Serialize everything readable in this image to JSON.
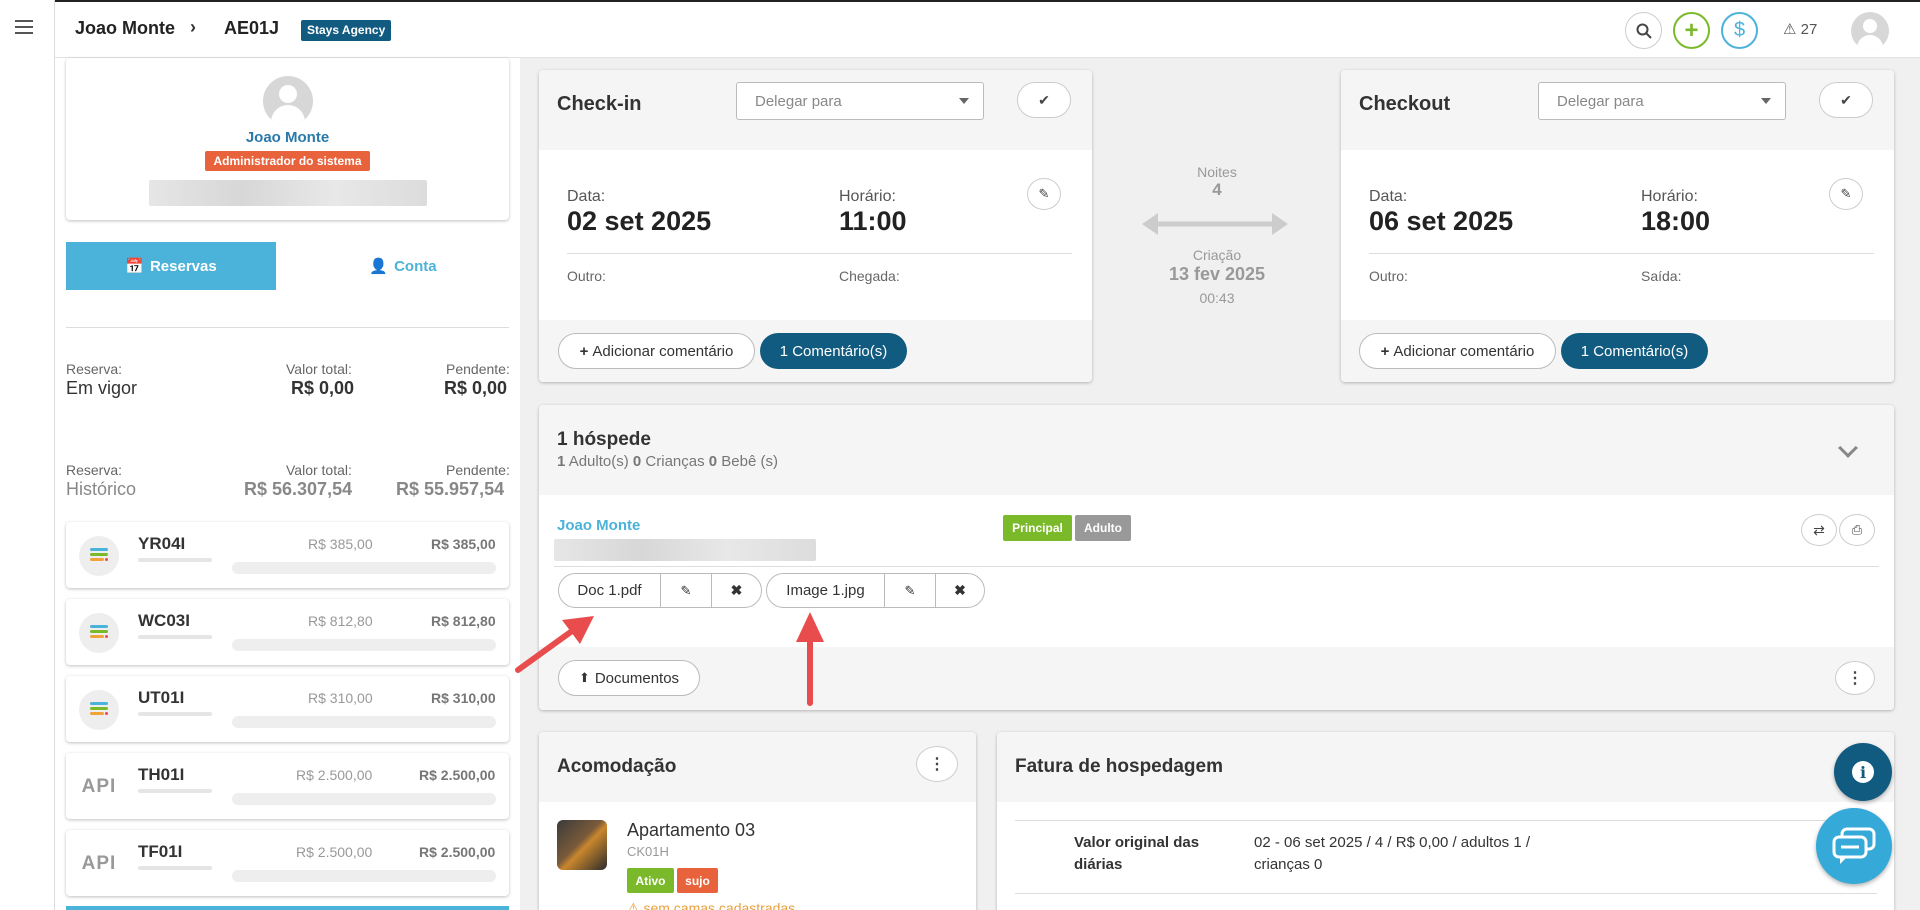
{
  "header": {
    "guest_name": "Joao Monte",
    "reservation_code": "AE01J",
    "agency_badge": "Stays Agency",
    "alerts_count": "27"
  },
  "profile": {
    "name": "Joao Monte",
    "role": "Administrador do sistema"
  },
  "side_tabs": {
    "reservations": "Reservas",
    "account": "Conta"
  },
  "summary_current": {
    "reserva_label": "Reserva:",
    "reserva_value": "Em vigor",
    "total_label": "Valor total:",
    "total_value": "R$ 0,00",
    "pending_label": "Pendente:",
    "pending_value": "R$ 0,00"
  },
  "summary_history": {
    "reserva_label": "Reserva:",
    "reserva_value": "Histórico",
    "total_label": "Valor total:",
    "total_value": "R$ 56.307,54",
    "pending_label": "Pendente:",
    "pending_value": "R$ 55.957,54"
  },
  "reservations": [
    {
      "code": "YR04I",
      "total": "R$ 385,00",
      "pending": "R$ 385,00",
      "source": "stack"
    },
    {
      "code": "WC03I",
      "total": "R$ 812,80",
      "pending": "R$ 812,80",
      "source": "stack"
    },
    {
      "code": "UT01I",
      "total": "R$ 310,00",
      "pending": "R$ 310,00",
      "source": "stack"
    },
    {
      "code": "TH01I",
      "total": "R$ 2.500,00",
      "pending": "R$ 2.500,00",
      "source": "API"
    },
    {
      "code": "TF01I",
      "total": "R$ 2.500,00",
      "pending": "R$ 2.500,00",
      "source": "API"
    }
  ],
  "checkin": {
    "title": "Check-in",
    "delegate_placeholder": "Delegar para",
    "date_label": "Data:",
    "date_value": "02 set 2025",
    "time_label": "Horário:",
    "time_value": "11:00",
    "other_label": "Outro:",
    "arrival_label": "Chegada:",
    "add_comment": "Adicionar comentário",
    "comments": "1 Comentário(s)"
  },
  "checkout": {
    "title": "Checkout",
    "delegate_placeholder": "Delegar para",
    "date_label": "Data:",
    "date_value": "06 set 2025",
    "time_label": "Horário:",
    "time_value": "18:00",
    "other_label": "Outro:",
    "departure_label": "Saída:",
    "add_comment": "Adicionar comentário",
    "comments": "1 Comentário(s)"
  },
  "stay": {
    "nights_label": "Noites",
    "nights_value": "4",
    "created_label": "Criação",
    "created_date": "13 fev 2025",
    "created_time": "00:43"
  },
  "guests": {
    "title": "1 hóspede",
    "adults_count": "1",
    "adults_label": "Adulto(s)",
    "children_count": "0",
    "children_label": "Crianças",
    "babies_count": "0",
    "babies_label": "Bebê (s)",
    "guest_name": "Joao Monte",
    "tag_principal": "Principal",
    "tag_adult": "Adulto",
    "doc1": "Doc 1.pdf",
    "doc2": "Image 1.jpg",
    "documents_button": "Documentos"
  },
  "accommodation": {
    "title": "Acomodação",
    "name": "Apartamento 03",
    "code": "CK01H",
    "tag_active": "Ativo",
    "tag_dirty": "sujo",
    "warning": "sem camas cadastradas"
  },
  "invoice": {
    "title": "Fatura de hospedagem",
    "row_label": "Valor original das diárias",
    "row_value": "02 - 06 set 2025  /  4 /  R$ 0,00  /  adultos 1 /  crianças 0"
  },
  "colors": {
    "primary_blue": "#4bb3d9",
    "dark_blue": "#125b80",
    "accent_green": "#7ab929",
    "badge_orange": "#e8623c",
    "arrow_red": "#e84c4c"
  }
}
